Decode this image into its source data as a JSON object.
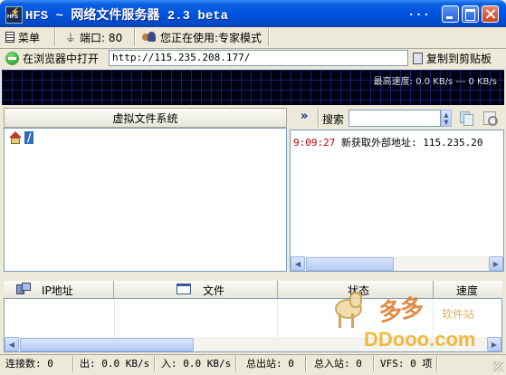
{
  "title": "HFS ~ 网络文件服务器 2.3 beta",
  "title_dots": "...",
  "toolbar": {
    "menu_label": "菜单",
    "port_label": "端口: 80",
    "mode_label": "您正在使用:专家模式"
  },
  "url_row": {
    "open_browser_label": "在浏览器中打开",
    "url_value": "http://115.235.208.177/",
    "copy_label": "复制到剪贴板"
  },
  "graph": {
    "speed_text": "最高速度: 0.0 KB/s --- 0 KB/s"
  },
  "vfs": {
    "header": "虚拟文件系统",
    "root_label": "/"
  },
  "search": {
    "label": "搜索",
    "value": ""
  },
  "log": {
    "entries": [
      {
        "time": "9:09:27",
        "message": "新获取外部地址: 115.235.20"
      }
    ]
  },
  "connections": {
    "columns": [
      "IP地址",
      "文件",
      "状态",
      "速度"
    ]
  },
  "status_bar": {
    "connections": "连接数: 0",
    "out": "出: 0.0 KB/s",
    "in": "入: 0.0 KB/s",
    "total_out": "总出站: 0",
    "total_in": "总入站: 0",
    "vfs": "VFS: 0 项"
  },
  "watermark": {
    "text": "多多软件站",
    "url": "DDooo.com"
  },
  "colors": {
    "title_bar": "#0054e3",
    "log_time": "#c00000",
    "graph_bg": "#000010"
  }
}
